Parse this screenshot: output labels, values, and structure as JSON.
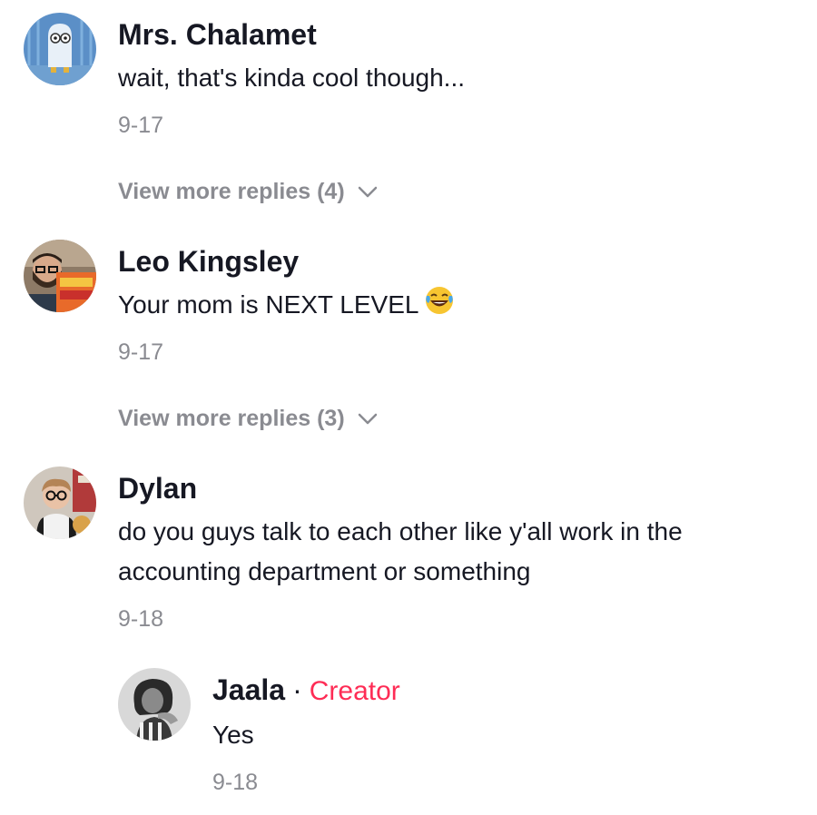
{
  "colors": {
    "username": "#161823",
    "text": "#161823",
    "meta": "#8a8b91",
    "creator_accent": "#fe2c55"
  },
  "comments": [
    {
      "username": "Mrs. Chalamet",
      "text": "wait, that's kinda cool though...",
      "date": "9-17",
      "view_more": "View more replies (4)",
      "avatar_icon": "ghost-avatar"
    },
    {
      "username": "Leo Kingsley",
      "text": "Your mom is NEXT LEVEL",
      "emoji": "laughing-tears-emoji",
      "date": "9-17",
      "view_more": "View more replies (3)",
      "avatar_icon": "person-avatar"
    },
    {
      "username": "Dylan",
      "text_line1": "do you guys talk to each other like y'all work in the",
      "text_line2": "accounting department or something",
      "date": "9-18",
      "avatar_icon": "person-avatar",
      "reply": {
        "username": "Jaala",
        "separator": "·",
        "badge": "Creator",
        "text": "Yes",
        "date": "9-18",
        "avatar_icon": "person-avatar"
      }
    }
  ]
}
